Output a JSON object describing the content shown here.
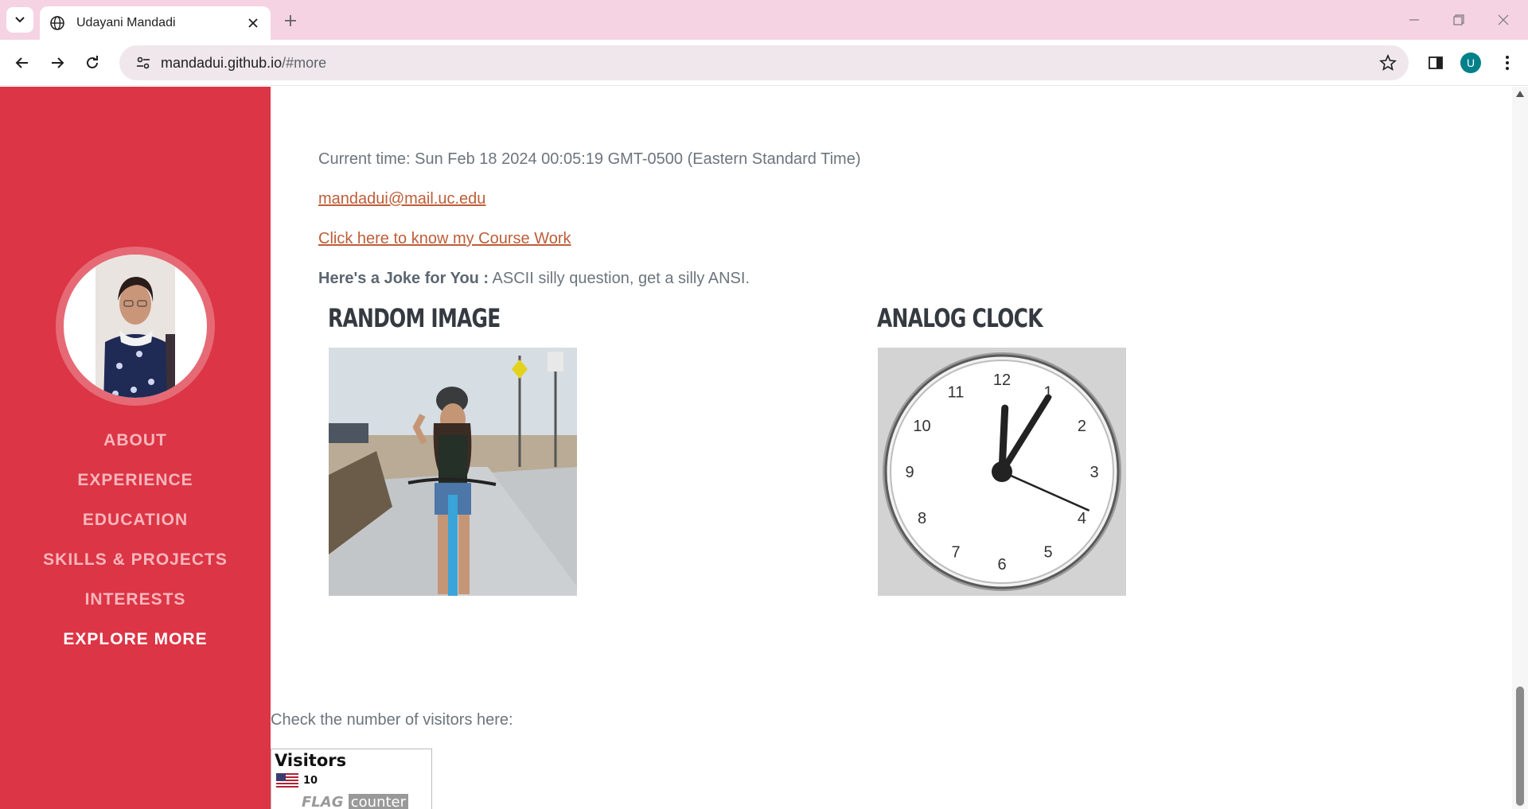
{
  "browser": {
    "tab_title": "Udayani Mandadi",
    "url_host": "mandadui.github.io",
    "url_path": "/#more",
    "profile_initial": "U"
  },
  "sidebar": {
    "background": "#dc3545",
    "nav_items": [
      {
        "label": "About",
        "active": false
      },
      {
        "label": "Experience",
        "active": false
      },
      {
        "label": "Education",
        "active": false
      },
      {
        "label": "Skills & Projects",
        "active": false
      },
      {
        "label": "Interests",
        "active": false
      },
      {
        "label": "Explore More",
        "active": true
      }
    ]
  },
  "main": {
    "current_time": "Current time: Sun Feb 18 2024 00:05:19 GMT-0500 (Eastern Standard Time)",
    "email": "mandadui@mail.uc.edu",
    "course_link": "Click here to know my Course Work",
    "joke_label": "Here's a Joke for You :",
    "joke_text": " ASCII silly question, get a silly ANSI.",
    "random_image_title": "RANDOM IMAGE",
    "analog_clock_title": "ANALOG CLOCK",
    "clock": {
      "hour": 0,
      "minute": 5,
      "second": 19
    },
    "visitors_label": "Check the number of visitors here:",
    "flag_counter": {
      "title": "Visitors",
      "country_flag": "us-flag",
      "count": "10",
      "brand_word1": "FLAG",
      "brand_word2": "counter"
    }
  },
  "colors": {
    "link": "#bd5d38",
    "heading": "#343a40",
    "text": "#6c757d"
  }
}
